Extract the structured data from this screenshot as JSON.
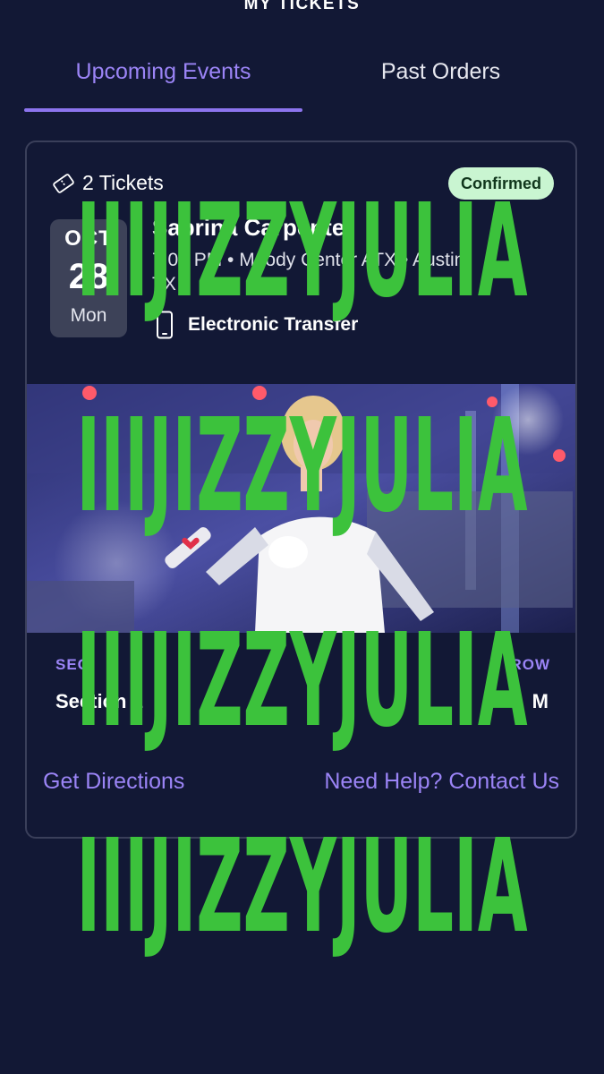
{
  "header": {
    "title": "MY TICKETS"
  },
  "tabs": [
    {
      "label": "Upcoming Events",
      "active": true
    },
    {
      "label": "Past Orders",
      "active": false
    }
  ],
  "order": {
    "tickets_label": "2 Tickets",
    "status": "Confirmed",
    "date": {
      "month": "OCT",
      "day": "28",
      "weekday": "Mon"
    },
    "event_name": "Sabrina Carpenter",
    "details": "7:00 PM • Moody Center ATX • Austin, TX",
    "delivery": "Electronic Transfer",
    "seating": {
      "sec_label": "SEC",
      "sec_value": "Section 1",
      "row_label": "ROW",
      "row_value": "M"
    },
    "links": {
      "directions": "Get Directions",
      "help": "Need Help? Contact Us"
    }
  },
  "watermark": "IIIJIZZYJULIA",
  "colors": {
    "background": "#121835",
    "accent": "#9b84f6",
    "badge_bg": "#c9f5d1",
    "watermark": "#3cc23c"
  },
  "icons": {
    "ticket": "ticket-icon",
    "delivery": "phone-icon"
  }
}
